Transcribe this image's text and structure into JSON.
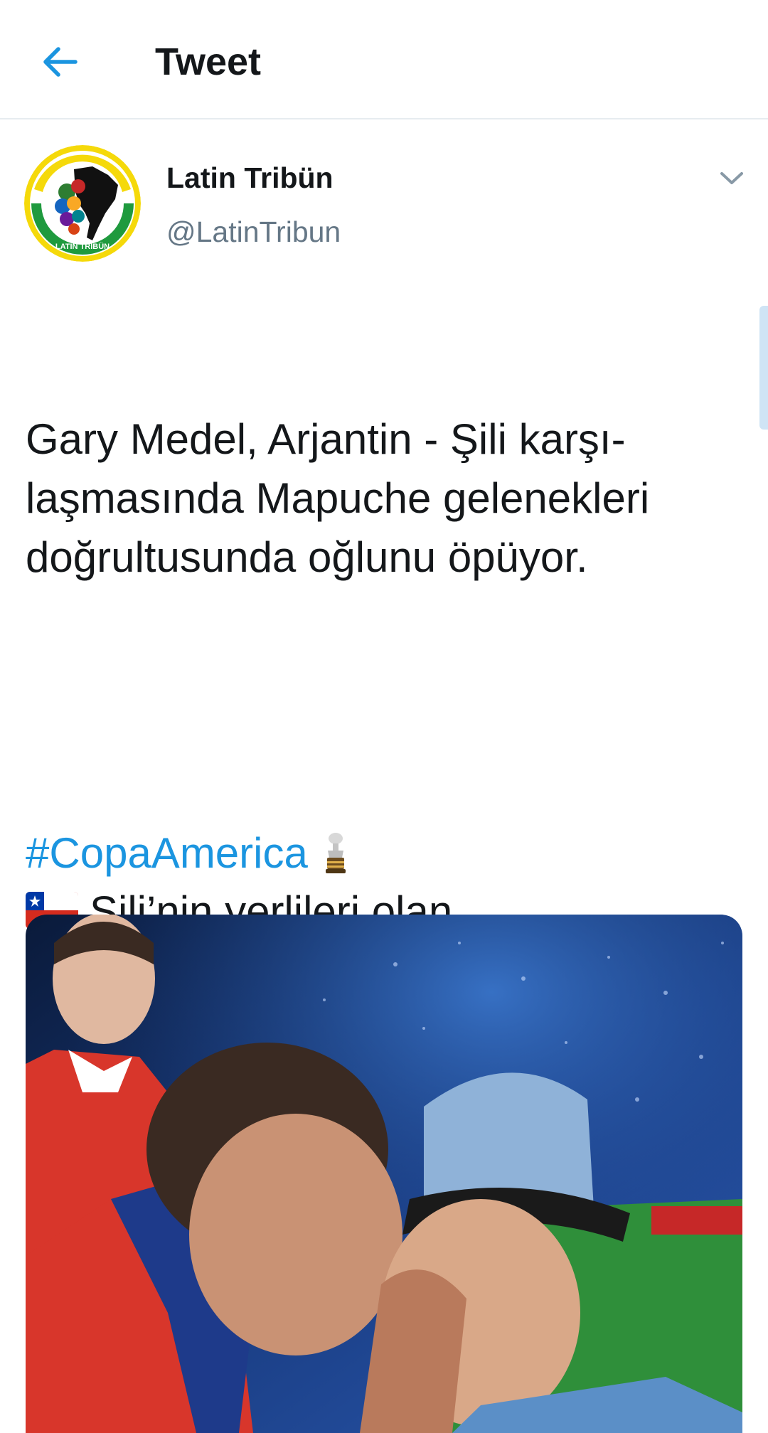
{
  "header": {
    "title": "Tweet",
    "back_icon": "arrow-left-icon"
  },
  "tweet": {
    "author": {
      "name": "Latin Tribün",
      "handle": "@LatinTribun",
      "avatar_text": "LATIN TRIBÜN"
    },
    "paragraph1": "Gary Medel, Arjantin - Şili karşı-\nlaşmasında Mapuche gelenekleri\ndoğrultusunda oğlunu öpüyor.",
    "paragraph2": "Şili’nin yerlileri olan\nMapucheler’de çocuklar, sadece\nanne ve babaları tarafından böyle\nsevilirler.",
    "hashtag": "#CopaAmerica",
    "flag_icon": "chile-flag-icon",
    "trophy_icon": "trophy-icon"
  },
  "colors": {
    "accent": "#1b95e0",
    "text": "#14171a",
    "secondary": "#657786",
    "divider": "#e6ecf0"
  }
}
